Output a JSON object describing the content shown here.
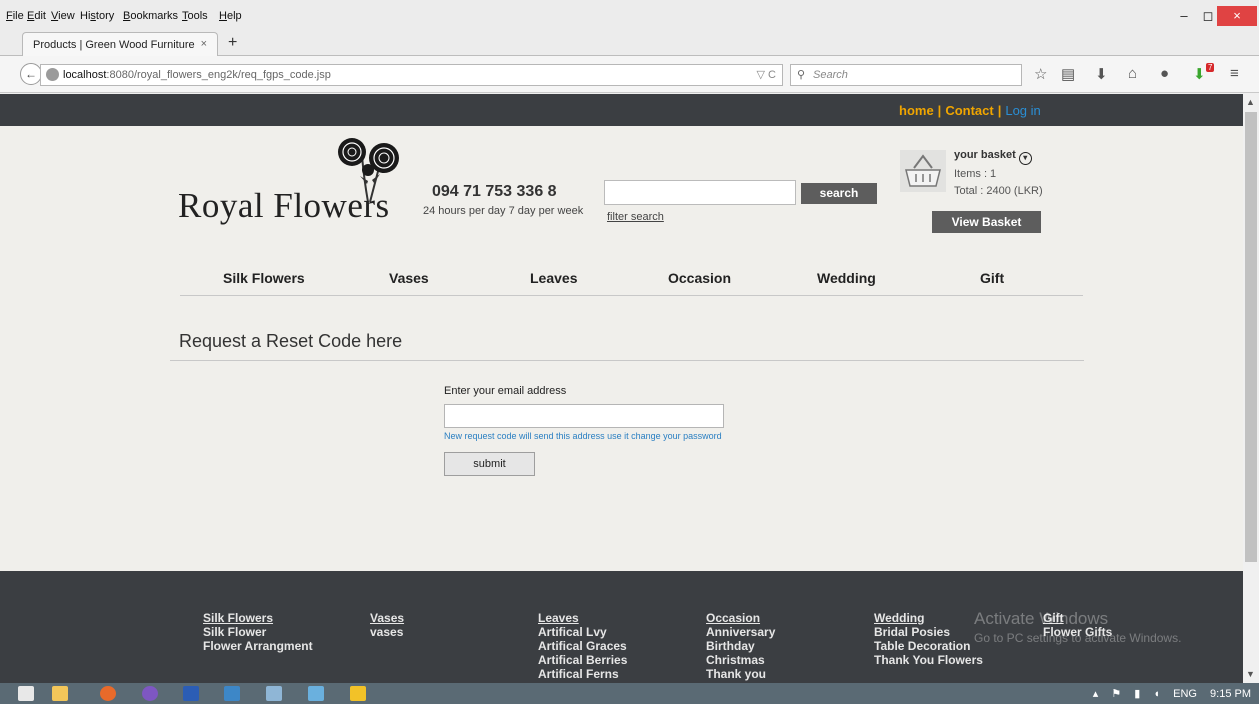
{
  "browser": {
    "menu": [
      "File",
      "Edit",
      "View",
      "History",
      "Bookmarks",
      "Tools",
      "Help"
    ],
    "menu_underlines": [
      "F",
      "E",
      "V",
      "s",
      "B",
      "T",
      "H"
    ],
    "window_controls": {
      "minimize": "–",
      "restore": "◻",
      "close": "×"
    },
    "tab_title": "Products | Green Wood Furniture",
    "tab_close": "×",
    "new_tab": "+",
    "url_host": "localhost",
    "url_path": ":8080/royal_flowers_eng2k/req_fgps_code.jsp",
    "url_tools": "▽ C",
    "search_placeholder": "Search",
    "toolbar_icons": [
      "star-icon",
      "reading-list-icon",
      "download-icon",
      "home-icon",
      "chat-icon",
      "addon-icon",
      "hamburger-menu-icon"
    ],
    "badge": "7"
  },
  "site": {
    "toplinks": {
      "home": "home",
      "contact": "Contact",
      "login": "Log in",
      "sep": "|"
    },
    "logo_text": "Royal Flowers",
    "phone": "094 71 753 336 8",
    "hours": "24 hours per day 7 day per week",
    "search_button": "search",
    "filter_search": "filter search",
    "basket": {
      "title": "your basket",
      "items": "Items : 1",
      "total": "Total : 2400 (LKR)",
      "view_button": "View Basket"
    },
    "categories": [
      "Silk Flowers",
      "Vases",
      "Leaves",
      "Occasion",
      "Wedding",
      "Gift"
    ],
    "reset": {
      "title": "Request a Reset Code here",
      "email_label": "Enter your email address",
      "hint": "New request code will send this address use it change your password",
      "submit": "submit"
    },
    "footer": [
      {
        "heading": "Silk Flowers",
        "items": [
          "Silk Flower",
          "Flower Arrangment"
        ]
      },
      {
        "heading": "Vases",
        "items": [
          "vases"
        ]
      },
      {
        "heading": "Leaves",
        "items": [
          "Artifical Lvy",
          "Artifical Graces",
          "Artifical Berries",
          "Artifical Ferns"
        ]
      },
      {
        "heading": "Occasion",
        "items": [
          "Anniversary",
          "Birthday",
          "Christmas",
          "Thank you"
        ]
      },
      {
        "heading": "Wedding",
        "items": [
          "Bridal Posies",
          "Table Decoration",
          "Thank You Flowers"
        ]
      },
      {
        "heading": "Gift",
        "items": [
          "Flower Gifts"
        ]
      }
    ],
    "watermark": {
      "line1": "Activate Windows",
      "line2": "Go to PC settings to activate Windows."
    }
  },
  "taskbar": {
    "lang": "ENG",
    "time": "9:15 PM"
  },
  "colors": {
    "dark_strip": "#3b3e42",
    "accent_orange": "#f0a500",
    "link_blue": "#2a8fd6",
    "button_gray": "#5d5d5d"
  }
}
